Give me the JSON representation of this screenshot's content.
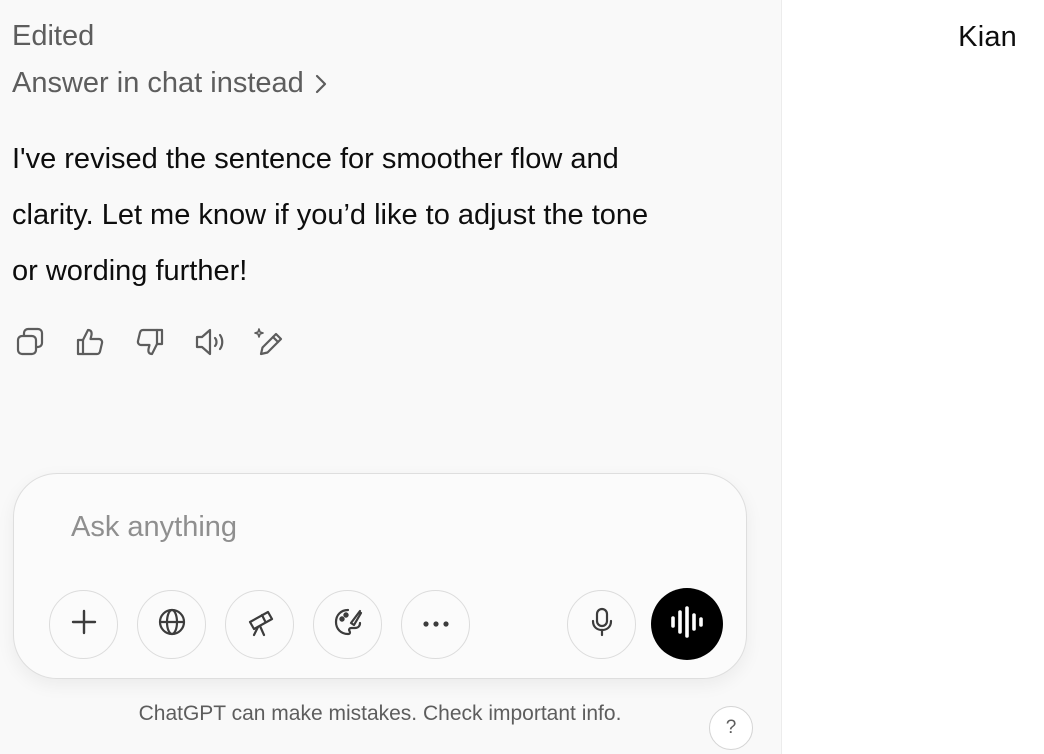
{
  "chat": {
    "status": "Edited",
    "answer_link": "Answer in chat instead",
    "message_lines": [
      "I've revised the sentence for smoother flow and",
      "clarity. Let me know if you’d like to adjust the tone",
      "or wording further!"
    ],
    "actions": [
      {
        "icon": "copy-icon"
      },
      {
        "icon": "thumbs-up-icon"
      },
      {
        "icon": "thumbs-down-icon"
      },
      {
        "icon": "read-aloud-icon"
      },
      {
        "icon": "edit-sparkle-icon"
      }
    ]
  },
  "composer": {
    "placeholder": "Ask anything",
    "value": "",
    "tools": [
      {
        "icon": "plus-icon"
      },
      {
        "icon": "globe-icon"
      },
      {
        "icon": "telescope-icon"
      },
      {
        "icon": "palette-icon"
      },
      {
        "icon": "more-icon"
      },
      {
        "icon": "microphone-icon"
      }
    ],
    "voice_icon": "voice-waveform-icon"
  },
  "footer": {
    "disclaimer": "ChatGPT can make mistakes. Check important info.",
    "help_label": "?"
  },
  "canvas": {
    "text": "Kian"
  },
  "colors": {
    "chat_background": "#f9f9f9",
    "canvas_background": "#ffffff",
    "voice_button": "#000000",
    "muted_text": "#5d5d5d"
  }
}
